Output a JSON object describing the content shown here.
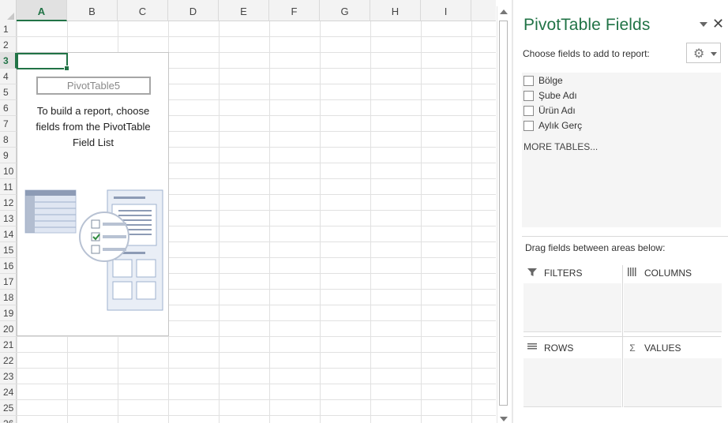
{
  "sheet": {
    "columns": [
      "A",
      "B",
      "C",
      "D",
      "E",
      "F",
      "G",
      "H",
      "I"
    ],
    "rows": [
      "1",
      "2",
      "3",
      "4",
      "5",
      "6",
      "7",
      "8",
      "9",
      "10",
      "11",
      "12",
      "13",
      "14",
      "15",
      "16",
      "17",
      "18",
      "19",
      "20",
      "21",
      "22",
      "23",
      "24",
      "25",
      "26"
    ],
    "active_column": "A",
    "active_row": "3"
  },
  "pivot_placeholder": {
    "name": "PivotTable5",
    "hint": "To build a report, choose fields from the PivotTable Field List"
  },
  "pane": {
    "title": "PivotTable Fields",
    "choose_label": "Choose fields to add to report:",
    "fields": [
      "Bölge",
      "Şube Adı",
      "Ürün Adı",
      "Aylık Gerç"
    ],
    "more_tables": "MORE TABLES...",
    "drag_label": "Drag fields between areas below:",
    "areas": {
      "filters": "FILTERS",
      "columns": "COLUMNS",
      "rows": "ROWS",
      "values": "VALUES"
    },
    "icons": {
      "menu": "chevron-down-icon",
      "close": "close-icon",
      "settings": "gear-icon",
      "filters": "filter-icon",
      "columns": "columns-icon",
      "rows": "rows-icon",
      "values": "sigma-icon"
    }
  },
  "colors": {
    "accent": "#217346",
    "gridline": "#e1e1e1"
  }
}
